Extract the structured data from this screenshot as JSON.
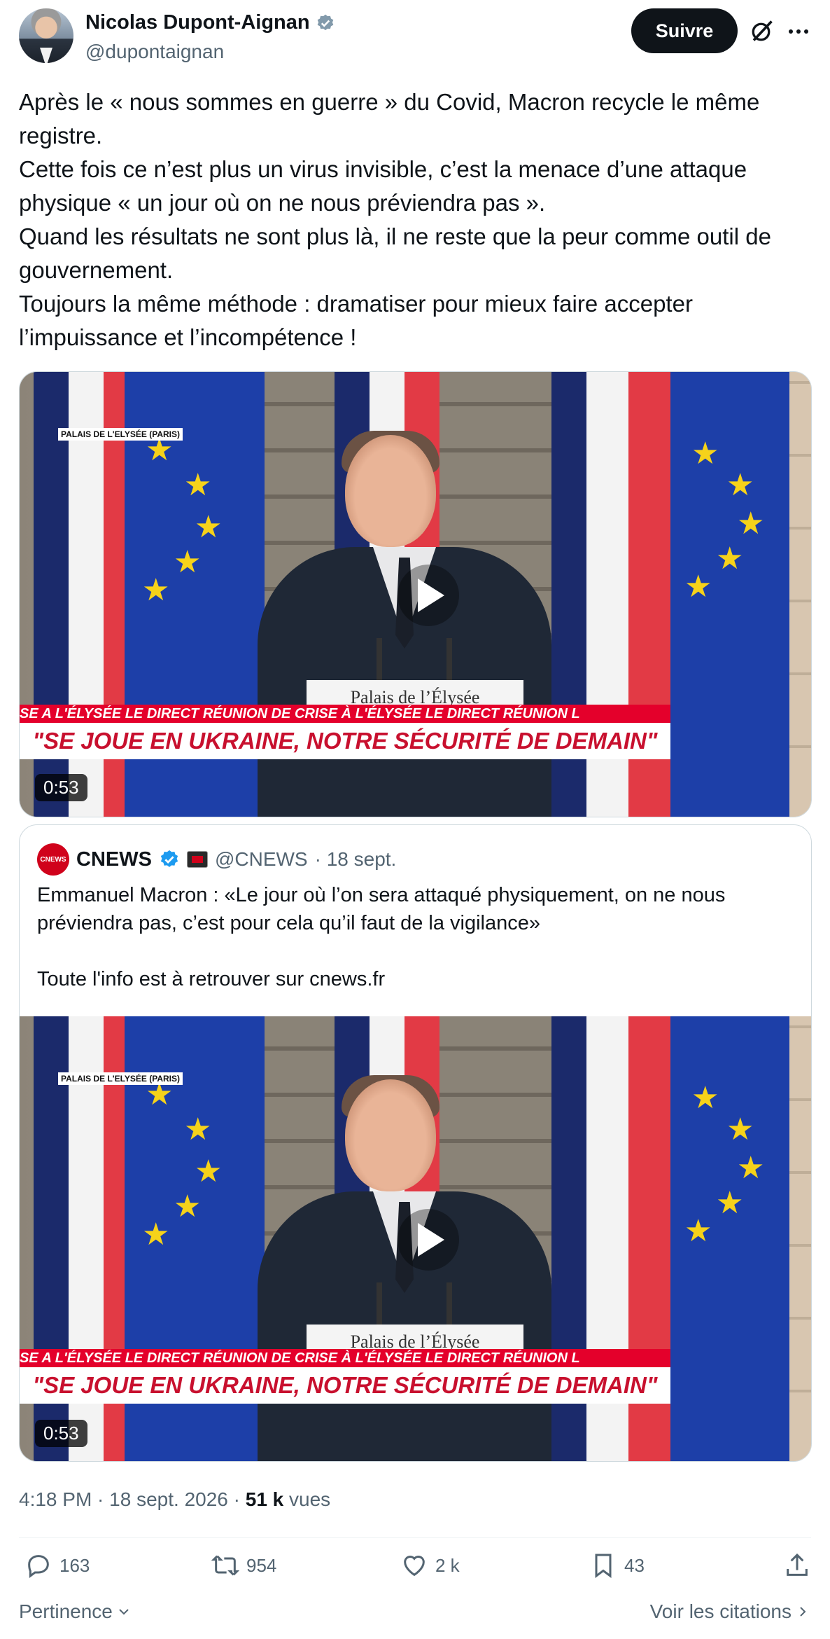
{
  "author": {
    "display_name": "Nicolas Dupont-Aignan",
    "handle": "@dupontaignan",
    "verified_icon": "verified-badge-icon"
  },
  "header": {
    "follow_label": "Suivre"
  },
  "tweet": {
    "lines": [
      "Après le « nous sommes en guerre » du Covid, Macron recycle le même registre.",
      "Cette fois ce n’est plus un virus invisible, c’est la menace d’une attaque physique « un jour où on ne nous préviendra pas ».",
      "Quand les résultats ne sont plus là, il ne reste que la peur comme outil de gouvernement.",
      "Toujours la même méthode : dramatiser pour mieux faire accepter l’impuissance et l’incompétence !"
    ]
  },
  "video": {
    "duration": "0:53",
    "location_tag": "PALAIS DE L'ELYSÉE (PARIS)",
    "ticker": "SE A L'ÉLYSÉE      LE DIRECT      RÉUNION DE CRISE À L'ÉLYSÉE      LE DIRECT      RÉUNION L",
    "banner": "\"SE JOUE EN UKRAINE, NOTRE SÉCURITÉ DE DEMAIN\"",
    "podium": "Palais de l’Élysée"
  },
  "quote": {
    "display_name": "CNEWS",
    "logo_text": "CNEWS",
    "handle": "@CNEWS",
    "date": "· 18 sept.",
    "lines": [
      "Emmanuel Macron : «Le jour où l’on sera attaqué physiquement, on ne nous préviendra pas, c’est pour cela qu’il faut de la vigilance»",
      "",
      "Toute l'info est à retrouver sur cnews.fr"
    ]
  },
  "meta": {
    "time": "4:18 PM · 18 sept. 2026 · ",
    "views_count": "51 k",
    "views_label": " vues"
  },
  "actions": {
    "replies": "163",
    "reposts": "954",
    "likes": "2 k",
    "bookmarks": "43"
  },
  "footer": {
    "sort_label": "Pertinence",
    "quotes_label": "Voir les citations"
  }
}
